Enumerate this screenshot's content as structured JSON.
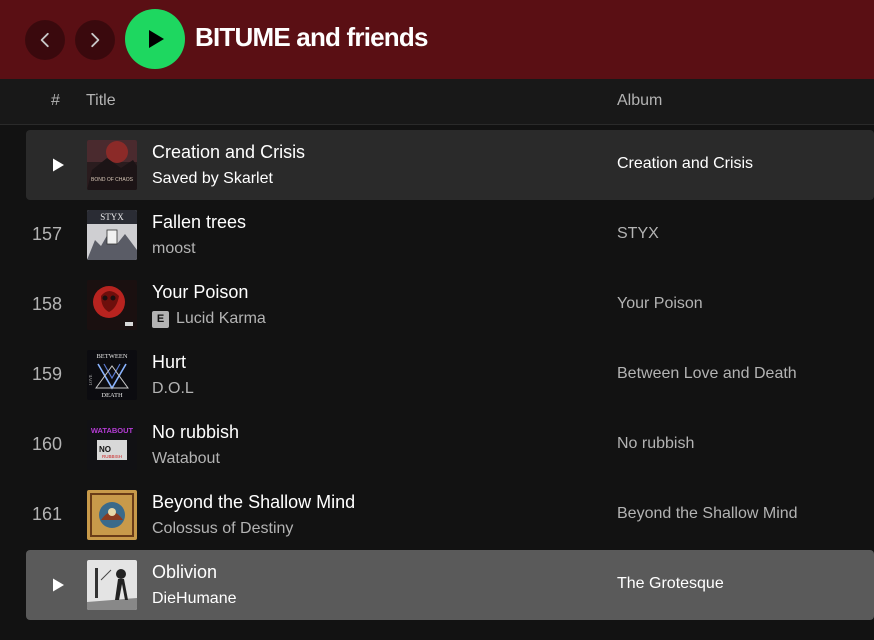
{
  "colors": {
    "topbar_bg": "#5a0f14",
    "accent_green": "#1ed760",
    "background": "#121212",
    "secondary_text": "#b3b3b3"
  },
  "header": {
    "title": "BITUME and friends",
    "back_icon": "chevron-left-icon",
    "forward_icon": "chevron-right-icon",
    "play_icon": "play-icon"
  },
  "columns": {
    "number": "#",
    "title": "Title",
    "album": "Album"
  },
  "tracks": [
    {
      "number": "",
      "title": "Creation and Crisis",
      "artist": "Saved by Skarlet",
      "album": "Creation and Crisis",
      "explicit": false,
      "state": "hover"
    },
    {
      "number": "157",
      "title": "Fallen trees",
      "artist": "moost",
      "album": "STYX",
      "explicit": false,
      "state": "normal"
    },
    {
      "number": "158",
      "title": "Your Poison",
      "artist": "Lucid Karma",
      "album": "Your Poison",
      "explicit": true,
      "explicit_label": "E",
      "state": "normal"
    },
    {
      "number": "159",
      "title": "Hurt",
      "artist": "D.O.L",
      "album": "Between Love and Death",
      "explicit": false,
      "state": "normal"
    },
    {
      "number": "160",
      "title": "No rubbish",
      "artist": "Watabout",
      "album": "No rubbish",
      "explicit": false,
      "state": "normal"
    },
    {
      "number": "161",
      "title": "Beyond the Shallow Mind",
      "artist": "Colossus of Destiny",
      "album": "Beyond the Shallow Mind",
      "explicit": false,
      "state": "normal"
    },
    {
      "number": "",
      "title": "Oblivion",
      "artist": "DieHumane",
      "album": "The Grotesque",
      "explicit": false,
      "state": "selected"
    }
  ],
  "covers": {
    "cover_0": "BOND OF CHAOS",
    "cover_1": "STYX",
    "cover_3_top": "BETWEEN",
    "cover_3_side": "LOVE",
    "cover_3_bottom": "DEATH",
    "cover_4_top": "WATABOUT",
    "cover_4_main": "NO",
    "cover_4_sub": "RUBBISH"
  }
}
